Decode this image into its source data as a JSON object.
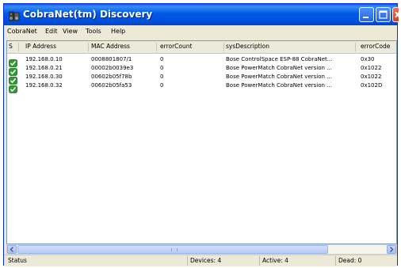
{
  "window": {
    "title": "CobraNet(tm) Discovery"
  },
  "menu": [
    "CobraNet",
    "Edit",
    "View",
    "Tools",
    "Help"
  ],
  "columns": [
    "S",
    "IP Address",
    "MAC Address",
    "errorCount",
    "sysDescription",
    "errorCode"
  ],
  "rows": [
    {
      "status": "ok",
      "ip": "192.168.0.10",
      "mac": "0008801807/1",
      "errorCount": "0",
      "sysDescription": "Bose ControlSpace ESP-88 CobraNet...",
      "errorCode": "0x30"
    },
    {
      "status": "ok",
      "ip": "192.168.0.21",
      "mac": "00002b0039e3",
      "errorCount": "0",
      "sysDescription": "Bose PowerMatch CobraNet version ...",
      "errorCode": "0x1022"
    },
    {
      "status": "ok",
      "ip": "192.168.0.30",
      "mac": "00602b05f78b",
      "errorCount": "0",
      "sysDescription": "Bose PowerMatch CobraNet version ...",
      "errorCode": "0x1022"
    },
    {
      "status": "ok",
      "ip": "192.168.0.32",
      "mac": "00602b05fa53",
      "errorCount": "0",
      "sysDescription": "Bose PowerMatch CobraNet version ...",
      "errorCode": "0x102D"
    }
  ],
  "statusbar": {
    "status": "Status",
    "devices": "Devices: 4",
    "active": "Active: 4",
    "dead": "Dead: 0"
  },
  "icons": {
    "app": "speaker-icon",
    "row_status": "checkmark-icon",
    "minimize": "minimize-icon",
    "maximize": "maximize-icon",
    "close": "close-icon"
  },
  "colors": {
    "titlebar": "#0058e8",
    "ok_status": "#2e9b2e",
    "close_button": "#c8431f"
  }
}
